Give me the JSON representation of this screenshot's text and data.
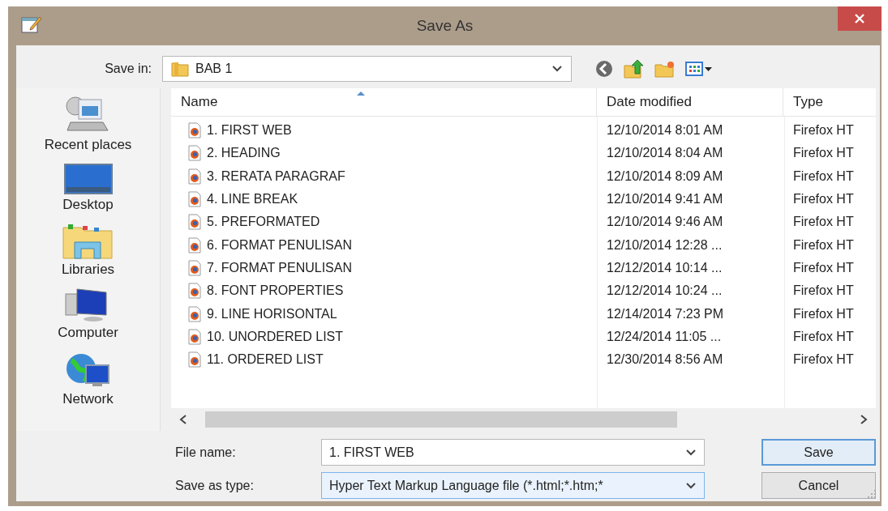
{
  "window": {
    "title": "Save As"
  },
  "save_in": {
    "label": "Save in:",
    "value": "BAB 1"
  },
  "places": [
    {
      "label": "Recent places",
      "kind": "recent"
    },
    {
      "label": "Desktop",
      "kind": "desktop"
    },
    {
      "label": "Libraries",
      "kind": "libraries"
    },
    {
      "label": "Computer",
      "kind": "computer"
    },
    {
      "label": "Network",
      "kind": "network"
    }
  ],
  "file_list": {
    "columns": [
      "Name",
      "Date modified",
      "Type"
    ],
    "rows": [
      {
        "name": "1. FIRST WEB",
        "date": "12/10/2014 8:01 AM",
        "type": "Firefox HT"
      },
      {
        "name": "2. HEADING",
        "date": "12/10/2014 8:04 AM",
        "type": "Firefox HT"
      },
      {
        "name": "3. RERATA PARAGRAF",
        "date": "12/10/2014 8:09 AM",
        "type": "Firefox HT"
      },
      {
        "name": "4. LINE BREAK",
        "date": "12/10/2014 9:41 AM",
        "type": "Firefox HT"
      },
      {
        "name": "5. PREFORMATED",
        "date": "12/10/2014 9:46 AM",
        "type": "Firefox HT"
      },
      {
        "name": "6. FORMAT PENULISAN",
        "date": "12/10/2014 12:28 ...",
        "type": "Firefox HT"
      },
      {
        "name": "7. FORMAT PENULISAN",
        "date": "12/12/2014 10:14 ...",
        "type": "Firefox HT"
      },
      {
        "name": "8. FONT PROPERTIES",
        "date": "12/12/2014 10:24 ...",
        "type": "Firefox HT"
      },
      {
        "name": "9. LINE HORISONTAL",
        "date": "12/14/2014 7:23 PM",
        "type": "Firefox HT"
      },
      {
        "name": "10. UNORDERED LIST",
        "date": "12/24/2014 11:05 ...",
        "type": "Firefox HT"
      },
      {
        "name": "11. ORDERED LIST",
        "date": "12/30/2014 8:56 AM",
        "type": "Firefox HT"
      }
    ]
  },
  "file_name": {
    "label": "File name:",
    "value": "1. FIRST WEB"
  },
  "save_as_type": {
    "label": "Save as type:",
    "value": "Hyper Text Markup Language file (*.html;*.htm;*"
  },
  "buttons": [
    {
      "label": "Save",
      "default": true
    },
    {
      "label": "Cancel",
      "default": false
    }
  ]
}
